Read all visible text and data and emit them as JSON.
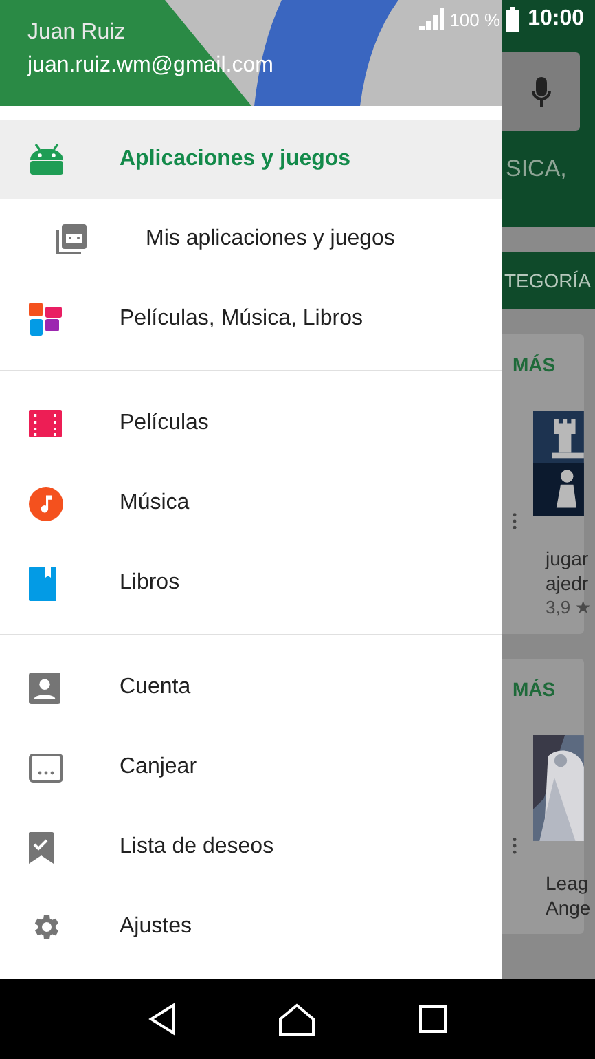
{
  "status_bar": {
    "battery": "100 %",
    "time": "10:00"
  },
  "account": {
    "name": "Juan Ruiz",
    "email": "juan.ruiz.wm@gmail.com"
  },
  "drawer_sections": [
    {
      "items": [
        {
          "kind": "apps",
          "label": "Aplicaciones y juegos",
          "selected": true,
          "indented": false
        },
        {
          "kind": "library",
          "label": "Mis aplicaciones y juegos",
          "selected": false,
          "indented": true
        },
        {
          "kind": "entertainment",
          "label": "Películas, Música, Libros",
          "selected": false,
          "indented": false
        }
      ]
    },
    {
      "items": [
        {
          "kind": "movies",
          "label": "Películas",
          "selected": false,
          "indented": false
        },
        {
          "kind": "music",
          "label": "Música",
          "selected": false,
          "indented": false
        },
        {
          "kind": "books",
          "label": "Libros",
          "selected": false,
          "indented": false
        }
      ]
    },
    {
      "items": [
        {
          "kind": "account",
          "label": "Cuenta",
          "selected": false,
          "indented": false
        },
        {
          "kind": "redeem",
          "label": "Canjear",
          "selected": false,
          "indented": false
        },
        {
          "kind": "wishlist",
          "label": "Lista de deseos",
          "selected": false,
          "indented": false
        },
        {
          "kind": "settings",
          "label": "Ajustes",
          "selected": false,
          "indented": false
        }
      ]
    }
  ],
  "background": {
    "banner_text": "SICA,",
    "tab": "TEGORÍA",
    "cards": [
      {
        "more": "MÁS",
        "title_lines": [
          "jugar",
          "ajedr"
        ],
        "rating": "3,9 ★"
      },
      {
        "more": "MÁS",
        "title_lines": [
          "Leag",
          "Ange"
        ]
      }
    ]
  }
}
